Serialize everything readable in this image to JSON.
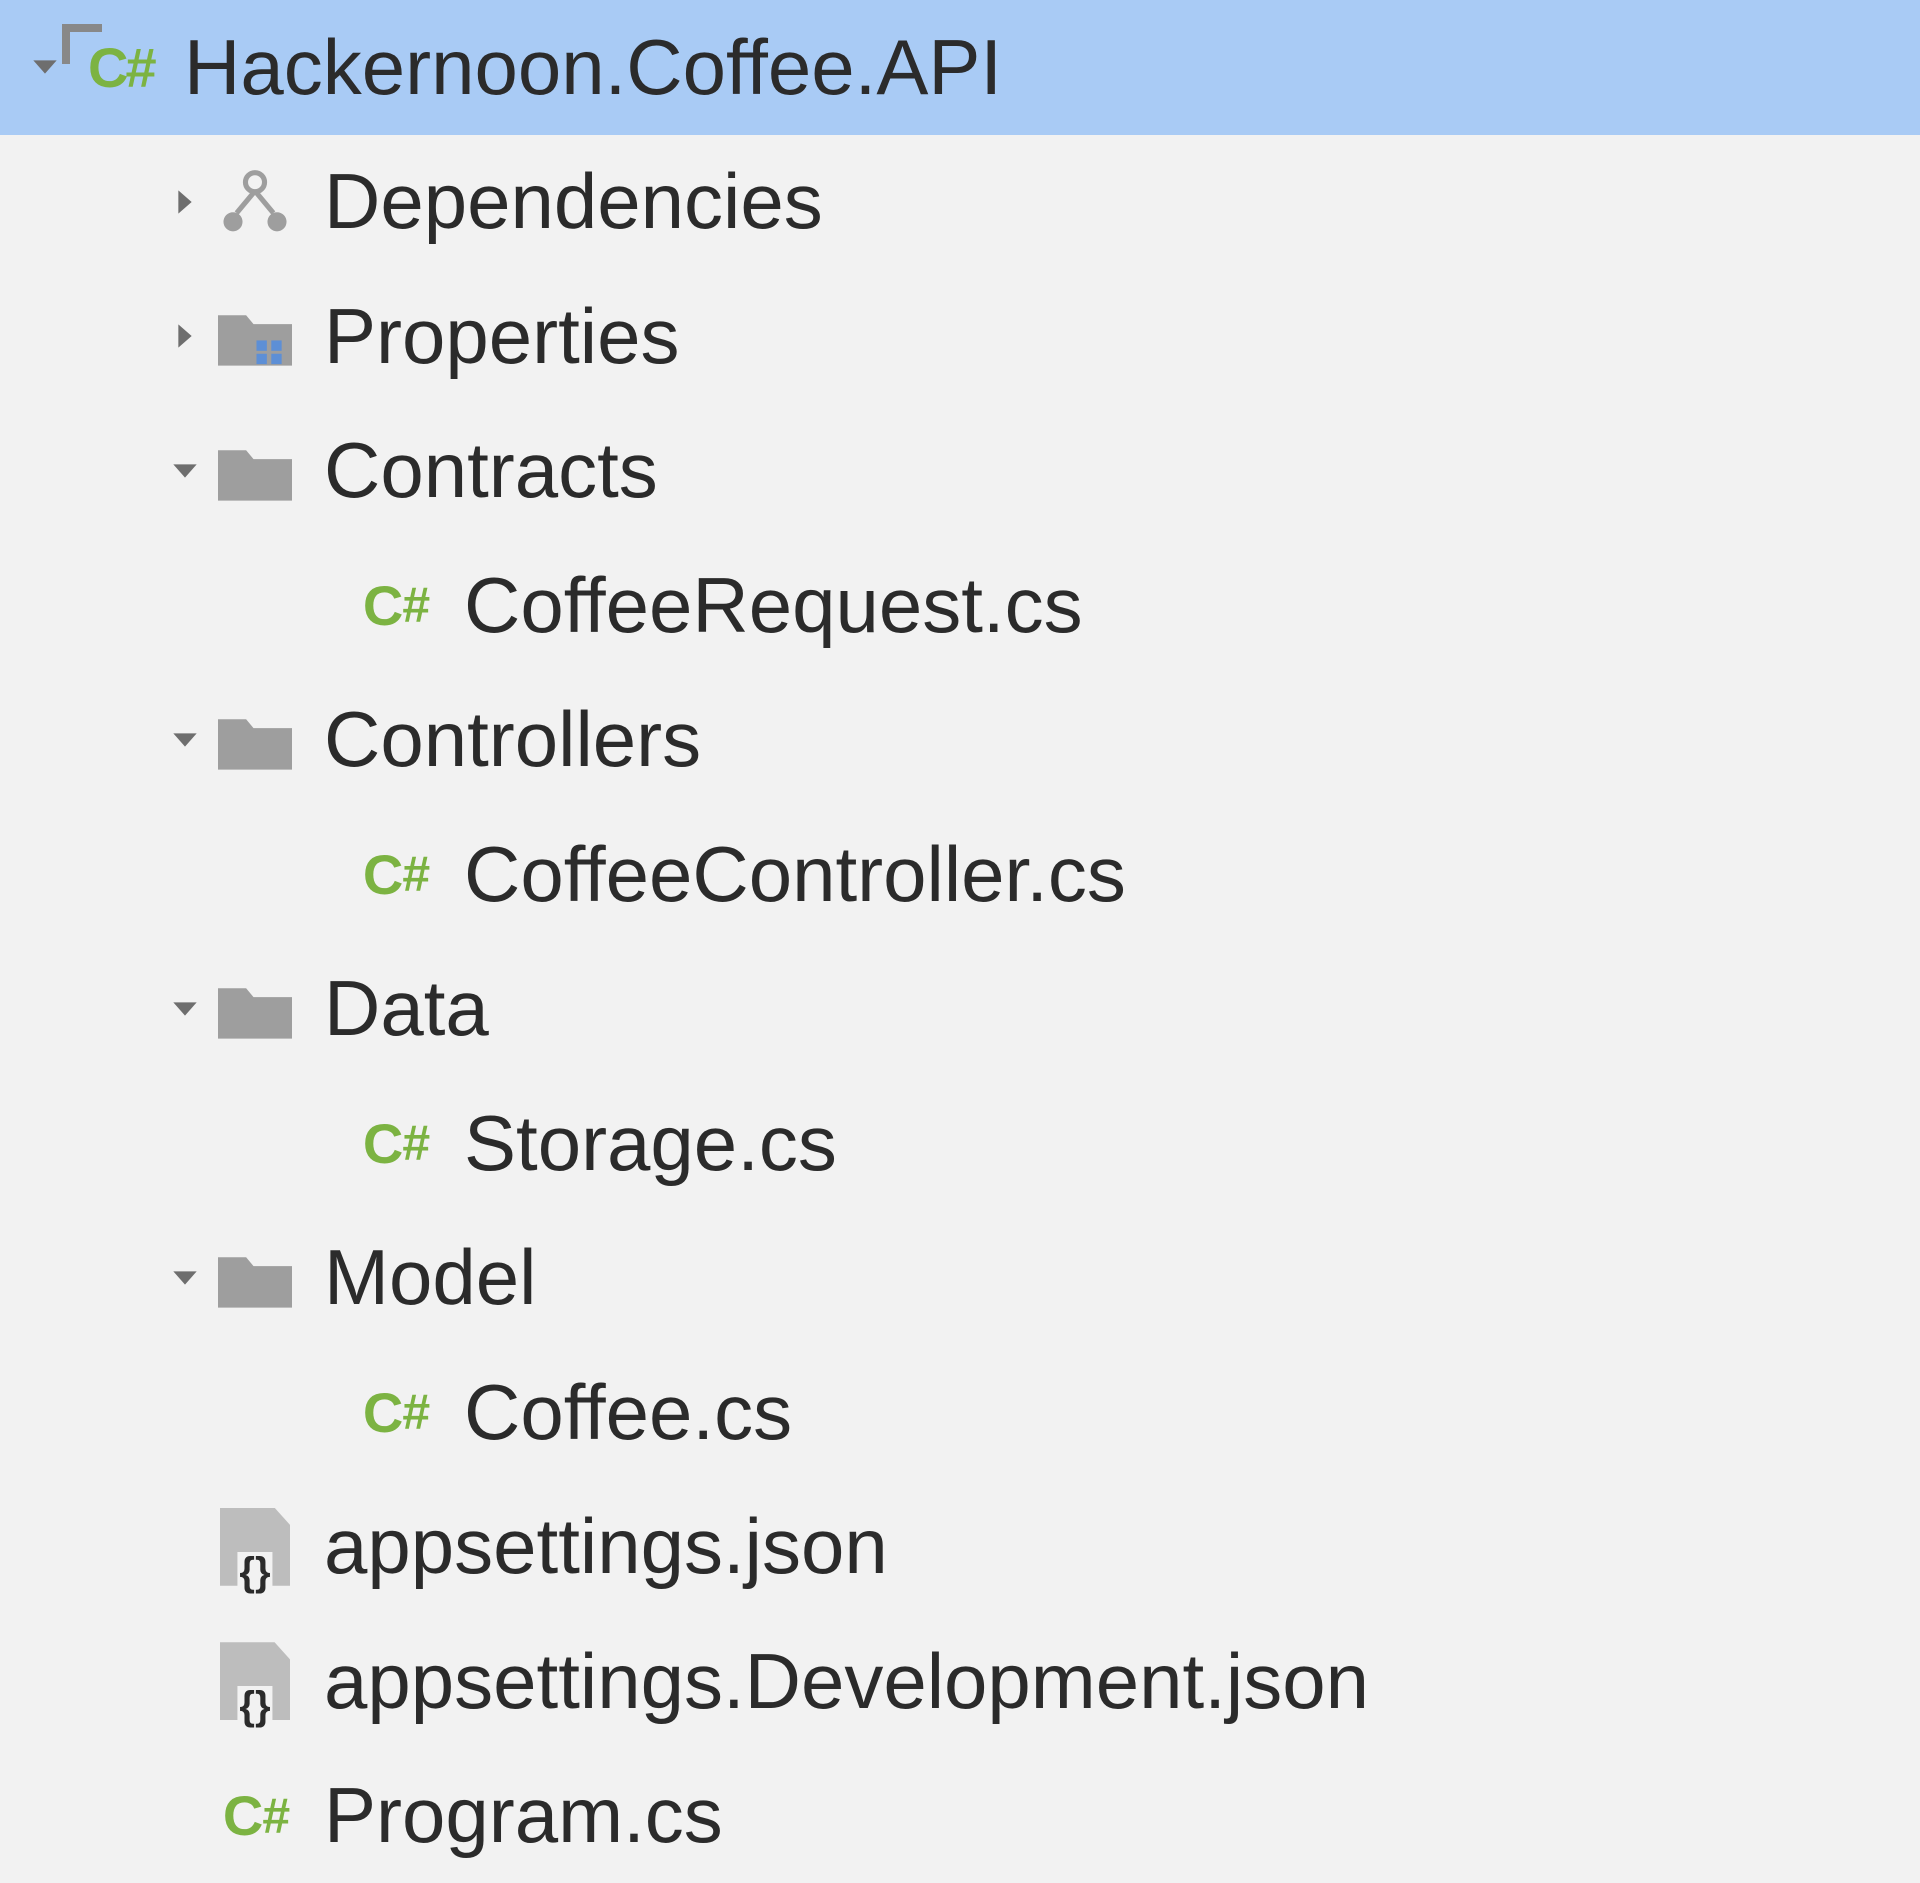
{
  "tree": {
    "project": "Hackernoon.Coffee.API",
    "dependencies": "Dependencies",
    "properties": "Properties",
    "contracts": "Contracts",
    "coffeeRequest": "CoffeeRequest.cs",
    "controllers": "Controllers",
    "coffeeController": "CoffeeController.cs",
    "data": "Data",
    "storage": "Storage.cs",
    "model": "Model",
    "coffee": "Coffee.cs",
    "appsettings": "appsettings.json",
    "appsettingsDev": "appsettings.Development.json",
    "program": "Program.cs"
  }
}
